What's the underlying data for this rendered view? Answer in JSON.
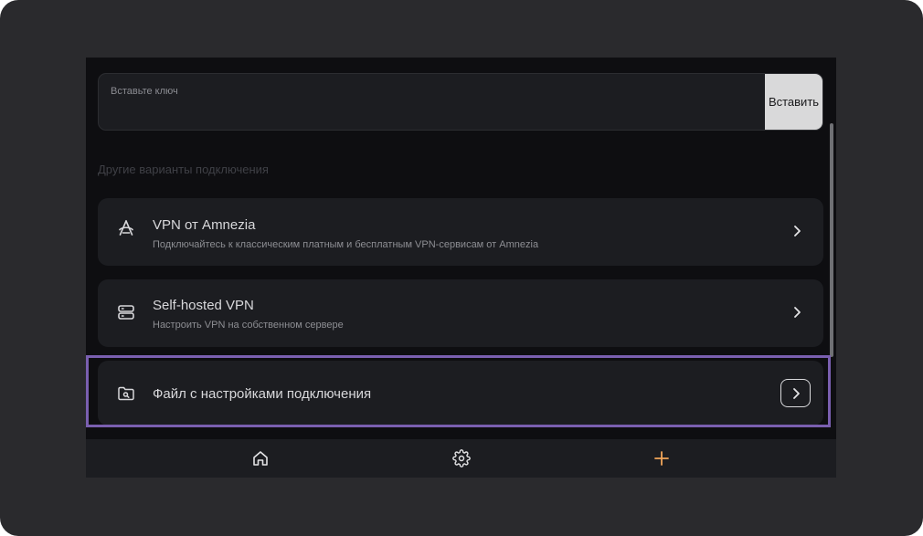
{
  "key_input": {
    "placeholder": "Вставьте ключ",
    "paste_label": "Вставить"
  },
  "section_title": "Другие варианты подключения",
  "options": [
    {
      "title": "VPN от Amnezia",
      "subtitle": "Подключайтесь к классическим платным и бесплатным VPN-сервисам от Amnezia",
      "icon": "amnezia-logo-icon"
    },
    {
      "title": "Self-hosted VPN",
      "subtitle": "Настроить VPN на собственном сервере",
      "icon": "server-icon"
    },
    {
      "title": "Файл с настройками подключения",
      "icon": "folder-search-icon"
    }
  ],
  "bottom_nav": [
    "home-icon",
    "settings-icon",
    "plus-icon"
  ],
  "colors": {
    "background": "#0e0e11",
    "card": "#1c1d21",
    "accent": "#f2a65a",
    "highlight": "#7a5fb0"
  }
}
